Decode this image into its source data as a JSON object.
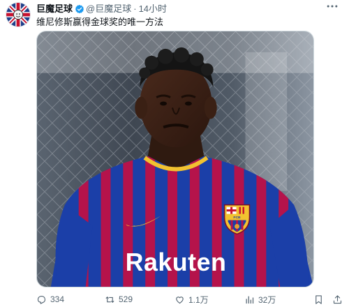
{
  "post": {
    "author_name": "巨魔足球",
    "handle": "@巨魔足球",
    "separator": "·",
    "time": "14小时",
    "text": "维尼修斯赢得金球奖的唯一方法",
    "more_icon": "more-horizontal-icon",
    "verified_icon": "verified-badge-icon",
    "verified_color": "#1d9bf0"
  },
  "media": {
    "kit_sponsor": "Rakuten",
    "badge_letters": "FCB"
  },
  "actions": {
    "replies": "334",
    "reposts": "529",
    "likes": "1.1万",
    "views": "32万",
    "icons": [
      "reply-icon",
      "repost-icon",
      "like-icon",
      "views-icon",
      "bookmark-icon",
      "share-icon"
    ]
  },
  "colors": {
    "text_primary": "#0f1419",
    "text_secondary": "#536471",
    "kit_blue": "#1b3fa8",
    "kit_red": "#b5134b",
    "kit_yellow": "#f2c230"
  }
}
